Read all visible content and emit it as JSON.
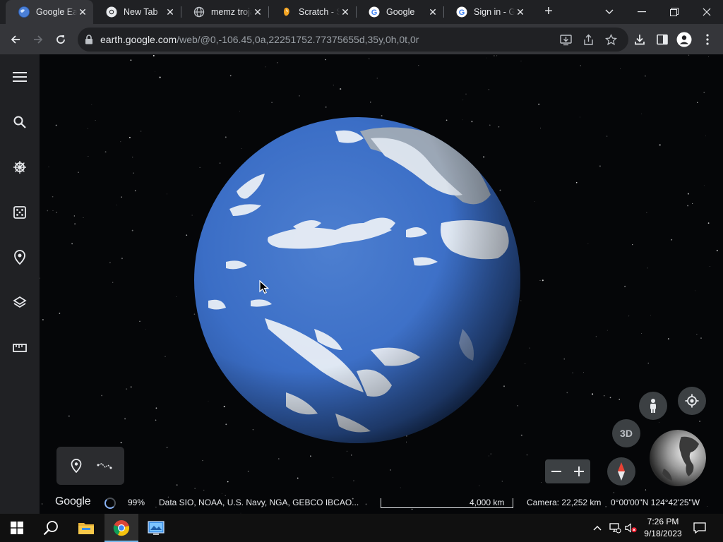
{
  "browser": {
    "tabs": [
      {
        "title": "Google Earth",
        "active": true,
        "icon": "earth-icon"
      },
      {
        "title": "New Tab",
        "active": false,
        "icon": "chrome-icon"
      },
      {
        "title": "memz trojan",
        "active": false,
        "icon": "globe-icon"
      },
      {
        "title": "Scratch - Search",
        "active": false,
        "icon": "scratch-icon"
      },
      {
        "title": "Google",
        "active": false,
        "icon": "google-icon"
      },
      {
        "title": "Sign in - Google",
        "active": false,
        "icon": "google-icon"
      }
    ],
    "url_host": "earth.google.com",
    "url_path": "/web/@0,-106.45,0a,22251752.77375655d,35y,0h,0t,0r"
  },
  "earth": {
    "logo": "Google",
    "loading_percent": "99%",
    "attribution": "Data SIO, NOAA, U.S. Navy, NGA, GEBCO  IBCAO...",
    "scale_label": "4,000 km",
    "camera": "Camera: 22,252 km",
    "coordinates": "0°00'00\"N 124°42'25\"W",
    "button_3d": "3D"
  },
  "taskbar": {
    "time": "7:26 PM",
    "date": "9/18/2023"
  },
  "colors": {
    "tabstrip_bg": "#202124",
    "toolbar_bg": "#35363a",
    "sidebar_bg": "#202124",
    "ocean": "#3f72c8",
    "taskbar_bg": "#101010"
  }
}
